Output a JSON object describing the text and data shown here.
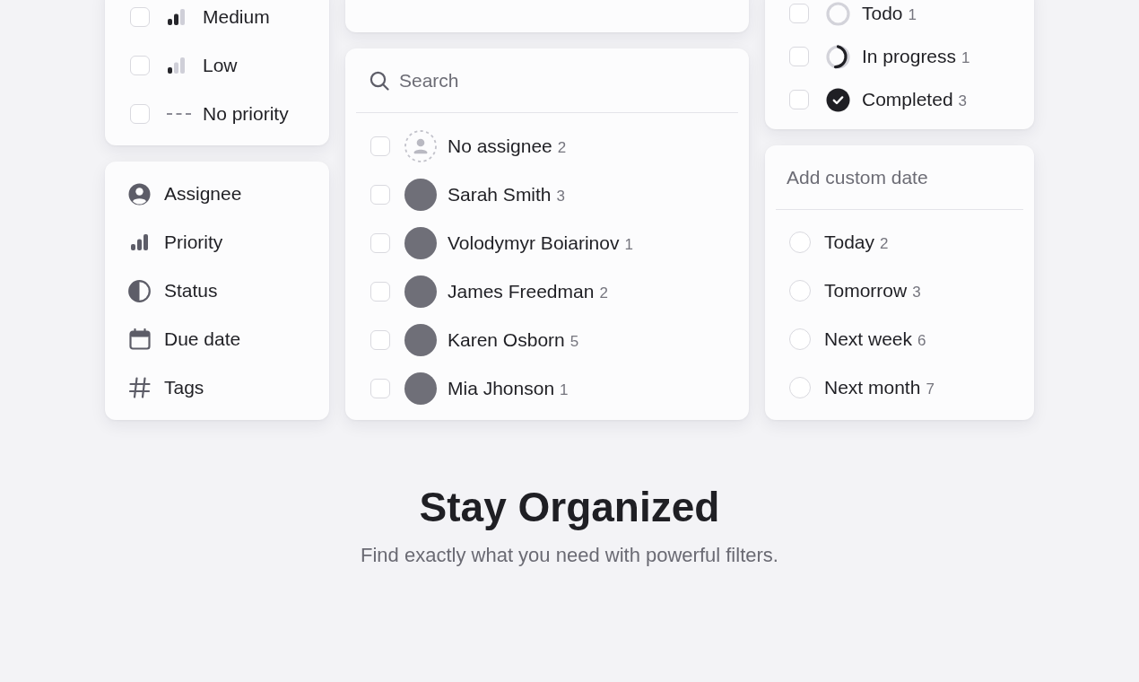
{
  "priority_card": {
    "items": [
      {
        "kind": "medium",
        "label": "Medium",
        "checked": false
      },
      {
        "kind": "low",
        "label": "Low",
        "checked": false
      },
      {
        "kind": "none",
        "label": "No priority",
        "checked": false
      }
    ]
  },
  "filter_menu": {
    "items": [
      {
        "kind": "assignee",
        "label": "Assignee"
      },
      {
        "kind": "priority",
        "label": "Priority"
      },
      {
        "kind": "status",
        "label": "Status"
      },
      {
        "kind": "date",
        "label": "Due date"
      },
      {
        "kind": "tags",
        "label": "Tags"
      }
    ]
  },
  "assignee_card": {
    "search": {
      "placeholder": "Search"
    },
    "items": [
      {
        "kind": "none",
        "name": "No assignee",
        "count": "2",
        "checked": false
      },
      {
        "kind": "photo",
        "name": "Sarah Smith",
        "count": "3",
        "checked": false
      },
      {
        "kind": "photo",
        "name": "Volodymyr Boiarinov",
        "count": "1",
        "checked": false
      },
      {
        "kind": "photo",
        "name": "James Freedman",
        "count": "2",
        "checked": false
      },
      {
        "kind": "photo",
        "name": "Karen Osborn",
        "count": "5",
        "checked": false
      },
      {
        "kind": "photo",
        "name": "Mia Jhonson",
        "count": "1",
        "checked": false
      }
    ]
  },
  "status_card": {
    "items": [
      {
        "kind": "todo",
        "label": "Todo",
        "count": "1",
        "checked": false
      },
      {
        "kind": "in_progress",
        "label": "In progress",
        "count": "1",
        "checked": false
      },
      {
        "kind": "completed",
        "label": "Completed",
        "count": "3",
        "checked": false
      }
    ]
  },
  "due_date_card": {
    "custom_date": {
      "placeholder": "Add custom date"
    },
    "items": [
      {
        "label": "Today",
        "count": "2",
        "selected": false
      },
      {
        "label": "Tomorrow",
        "count": "3",
        "selected": false
      },
      {
        "label": "Next week",
        "count": "6",
        "selected": false
      },
      {
        "label": "Next month",
        "count": "7",
        "selected": false
      }
    ]
  },
  "hero": {
    "title": "Stay Organized",
    "subtitle": "Find exactly what you need with powerful filters."
  }
}
